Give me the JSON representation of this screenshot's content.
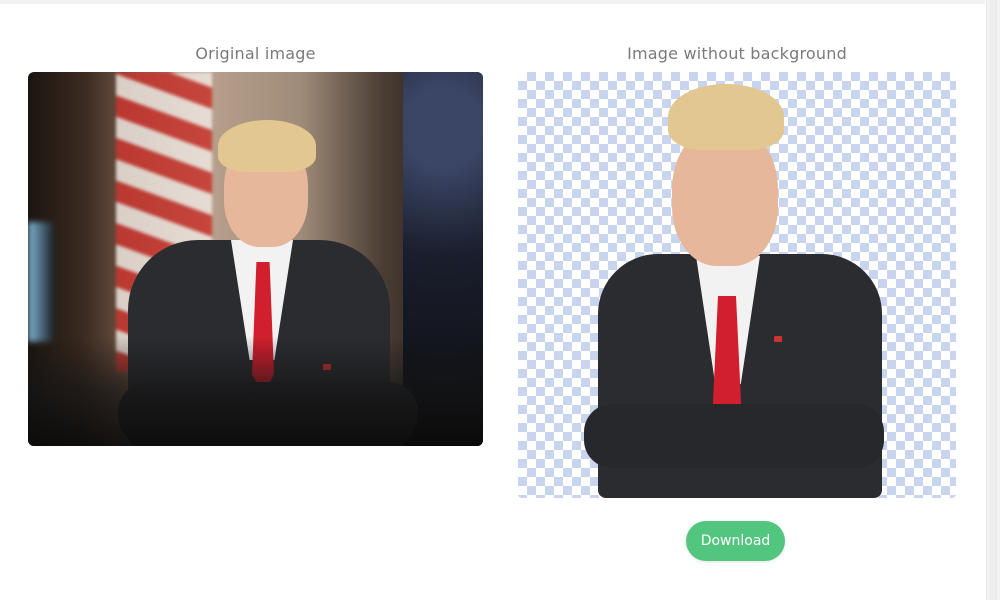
{
  "comparison": {
    "original_caption": "Original image",
    "result_caption": "Image without background"
  },
  "actions": {
    "download_label": "Download"
  },
  "colors": {
    "accent": "#52c57f",
    "caption_text": "#7a7a7a",
    "checker": "#c9d4ee"
  }
}
